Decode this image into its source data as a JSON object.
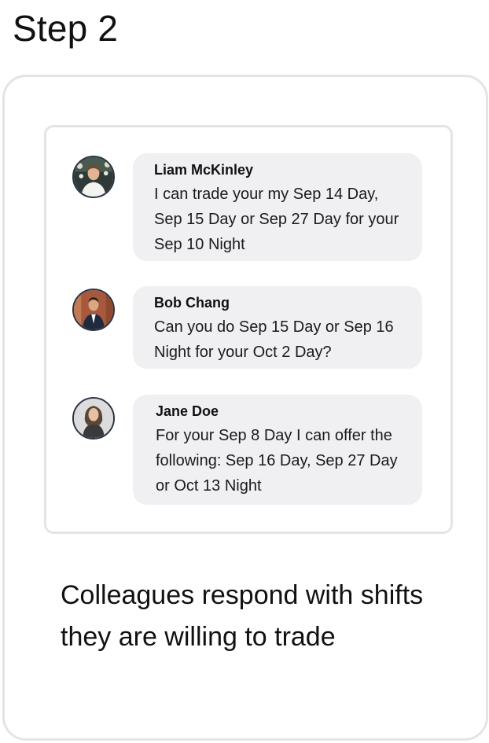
{
  "step_title": "Step 2",
  "messages": [
    {
      "name": "Liam McKinley",
      "text": "I can trade your my Sep 14 Day, Sep 15 Day or Sep 27 Day for your Sep 10 Night",
      "avatar_icon": "man-in-white-shirt-avatar"
    },
    {
      "name": "Bob Chang",
      "text": "Can you do Sep 15 Day or Sep 16 Night for your Oct 2 Day?",
      "avatar_icon": "man-in-suit-avatar"
    },
    {
      "name": "Jane Doe",
      "text": "For your Sep 8 Day I can offer the following: Sep 16 Day, Sep 27 Day or Oct 13 Night",
      "avatar_icon": "woman-portrait-avatar"
    }
  ],
  "caption": "Colleagues respond with shifts they are willing to trade",
  "colors": {
    "bubble_background": "#f0f0f3",
    "border": "#e4e4e7",
    "avatar_ring": "#2b3445"
  }
}
